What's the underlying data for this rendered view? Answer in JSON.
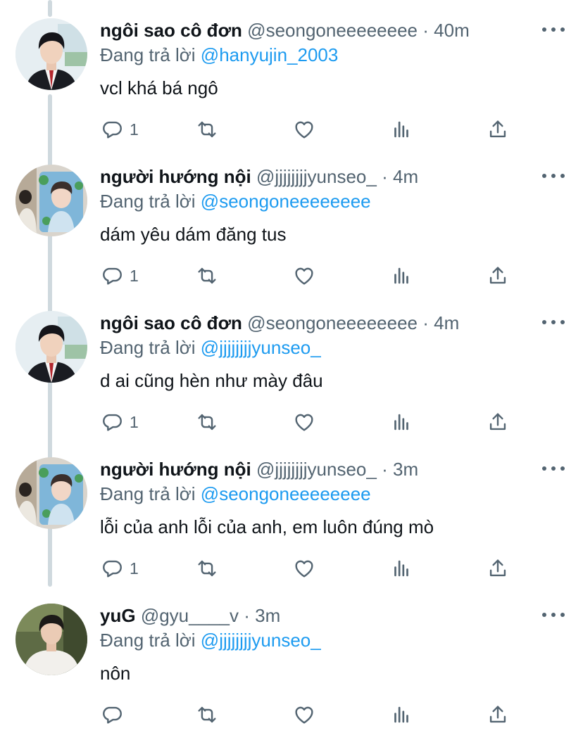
{
  "reply_prefix": "Đang trả lời",
  "icons": {
    "reply": "reply-icon",
    "retweet": "retweet-icon",
    "like": "heart-icon",
    "views": "bar-chart-icon",
    "share": "share-icon",
    "more": "more-options-icon"
  },
  "colors": {
    "mention": "#1d9bf0",
    "secondary_text": "#536471",
    "thread_line": "#cfd9de"
  },
  "tweets": [
    {
      "name": "ngôi sao cô đơn",
      "handle": "@seongoneeeeeeee",
      "time": "40m",
      "reply_to": "@hanyujin_2003",
      "text": "vcl khá bá ngô",
      "reply_count": "1"
    },
    {
      "name": "người hướng nội",
      "handle": "@jjjjjjjjyunseo_",
      "time": "4m",
      "reply_to": "@seongoneeeeeeee",
      "text": "dám yêu dám đăng tus",
      "reply_count": "1"
    },
    {
      "name": "ngôi sao cô đơn",
      "handle": "@seongoneeeeeeee",
      "time": "4m",
      "reply_to": "@jjjjjjjjyunseo_",
      "text": "d ai cũng hèn như mày đâu",
      "reply_count": "1"
    },
    {
      "name": "người hướng nội",
      "handle": "@jjjjjjjjyunseo_",
      "time": "3m",
      "reply_to": "@seongoneeeeeeee",
      "text": "lỗi của anh lỗi của anh, em luôn đúng mò",
      "reply_count": "1"
    },
    {
      "name": "yuG",
      "handle": "@gyu____v",
      "time": "3m",
      "reply_to": "@jjjjjjjjyunseo_",
      "text": "nôn",
      "reply_count": ""
    }
  ]
}
